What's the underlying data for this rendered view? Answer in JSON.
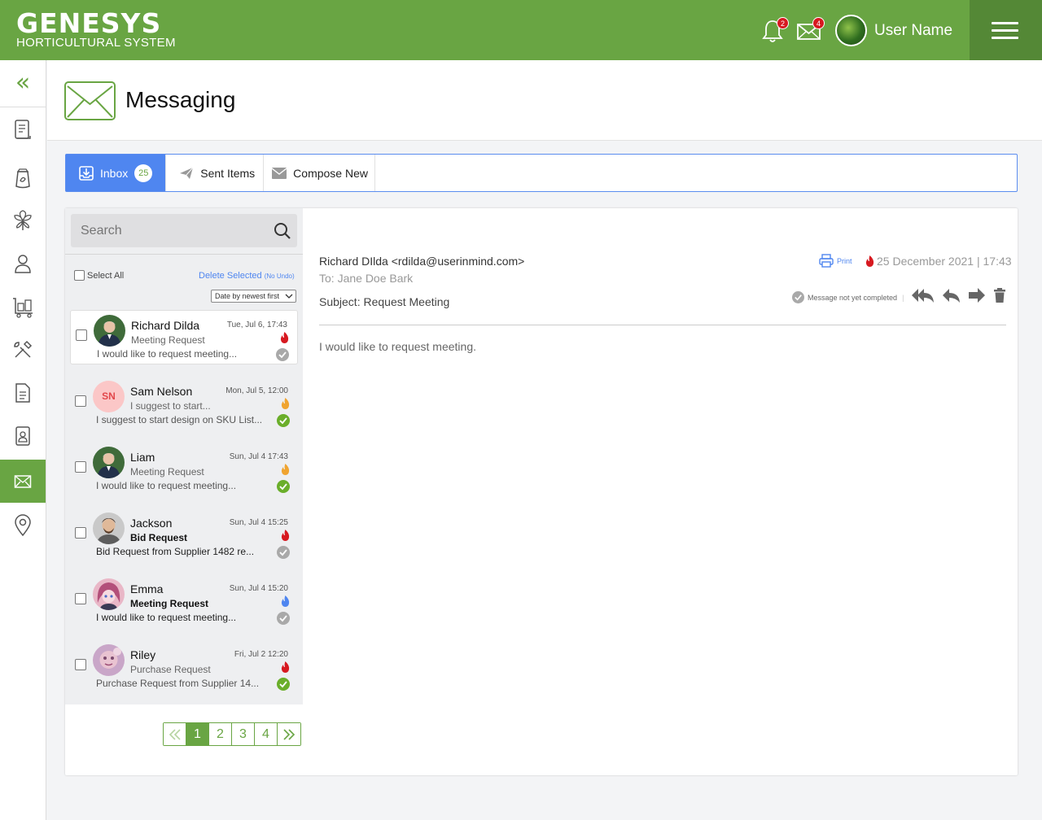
{
  "app": {
    "logo_main": "GENESYS",
    "logo_sub": "HORTICULTURAL SYSTEM",
    "notifications_count": "2",
    "messages_count": "4",
    "username": "User Name",
    "brand_color": "#69a543"
  },
  "sidebar": {
    "collapse_icon": "«",
    "items": [
      "document-list-icon",
      "seed-bag-icon",
      "plant-icon",
      "customer-icon",
      "warehouse-cart-icon",
      "tools-icon",
      "file-icon",
      "contact-card-icon",
      "envelope-icon",
      "location-pin-icon"
    ],
    "active": "envelope-icon"
  },
  "page": {
    "title": "Messaging"
  },
  "tabs": {
    "inbox": "Inbox",
    "inbox_count": "25",
    "sent": "Sent Items",
    "compose": "Compose New"
  },
  "list": {
    "search_placeholder": "Search",
    "select_all": "Select All",
    "delete_selected": "Delete Selected",
    "no_undo": "(No Undo)",
    "sort": "Date by newest first",
    "messages": [
      {
        "sender": "Richard Dilda",
        "date": "Tue, Jul 6, 17:43",
        "subject": "Meeting Request",
        "preview": "I would like to request meeting...",
        "priority": "high",
        "status": "pending"
      },
      {
        "sender": "Sam Nelson",
        "initials": "SN",
        "date": "Mon, Jul 5, 12:00",
        "subject": "I suggest to start...",
        "preview": "I suggest to start design on SKU List...",
        "priority": "medium",
        "status": "completed"
      },
      {
        "sender": "Liam",
        "date": "Sun, Jul 4 17:43",
        "subject": "Meeting Request",
        "preview": "I would like to request meeting...",
        "priority": "medium",
        "status": "completed"
      },
      {
        "sender": "Jackson",
        "date": "Sun, Jul 4 15:25",
        "subject": "Bid Request",
        "preview": "Bid Request from Supplier 1482 re...",
        "priority": "high",
        "status": "pending"
      },
      {
        "sender": "Emma",
        "date": "Sun, Jul 4 15:20",
        "subject": "Meeting Request",
        "preview": "I would like to request meeting...",
        "priority": "low",
        "status": "pending"
      },
      {
        "sender": "Riley",
        "date": "Fri, Jul 2 12:20",
        "subject": "Purchase Request",
        "preview": "Purchase Request from Supplier 14...",
        "priority": "high",
        "status": "completed"
      }
    ],
    "pages": [
      "1",
      "2",
      "3",
      "4"
    ],
    "current_page": "1"
  },
  "reader": {
    "from": "Richard DIlda <rdilda@userinmind.com>",
    "to": "To: Jane Doe Bark",
    "subject": "Subject: Request Meeting",
    "print": "Print",
    "date": "25 December 2021",
    "time": "17:43",
    "completed_status": "Message not yet completed",
    "body": "I would like to request meeting."
  },
  "colors": {
    "high": "#d71920",
    "medium": "#f0a430",
    "low": "#4f86f0",
    "done": "#6aae2a",
    "pending": "#a9a9a9",
    "tab_active": "#4f86f0"
  }
}
